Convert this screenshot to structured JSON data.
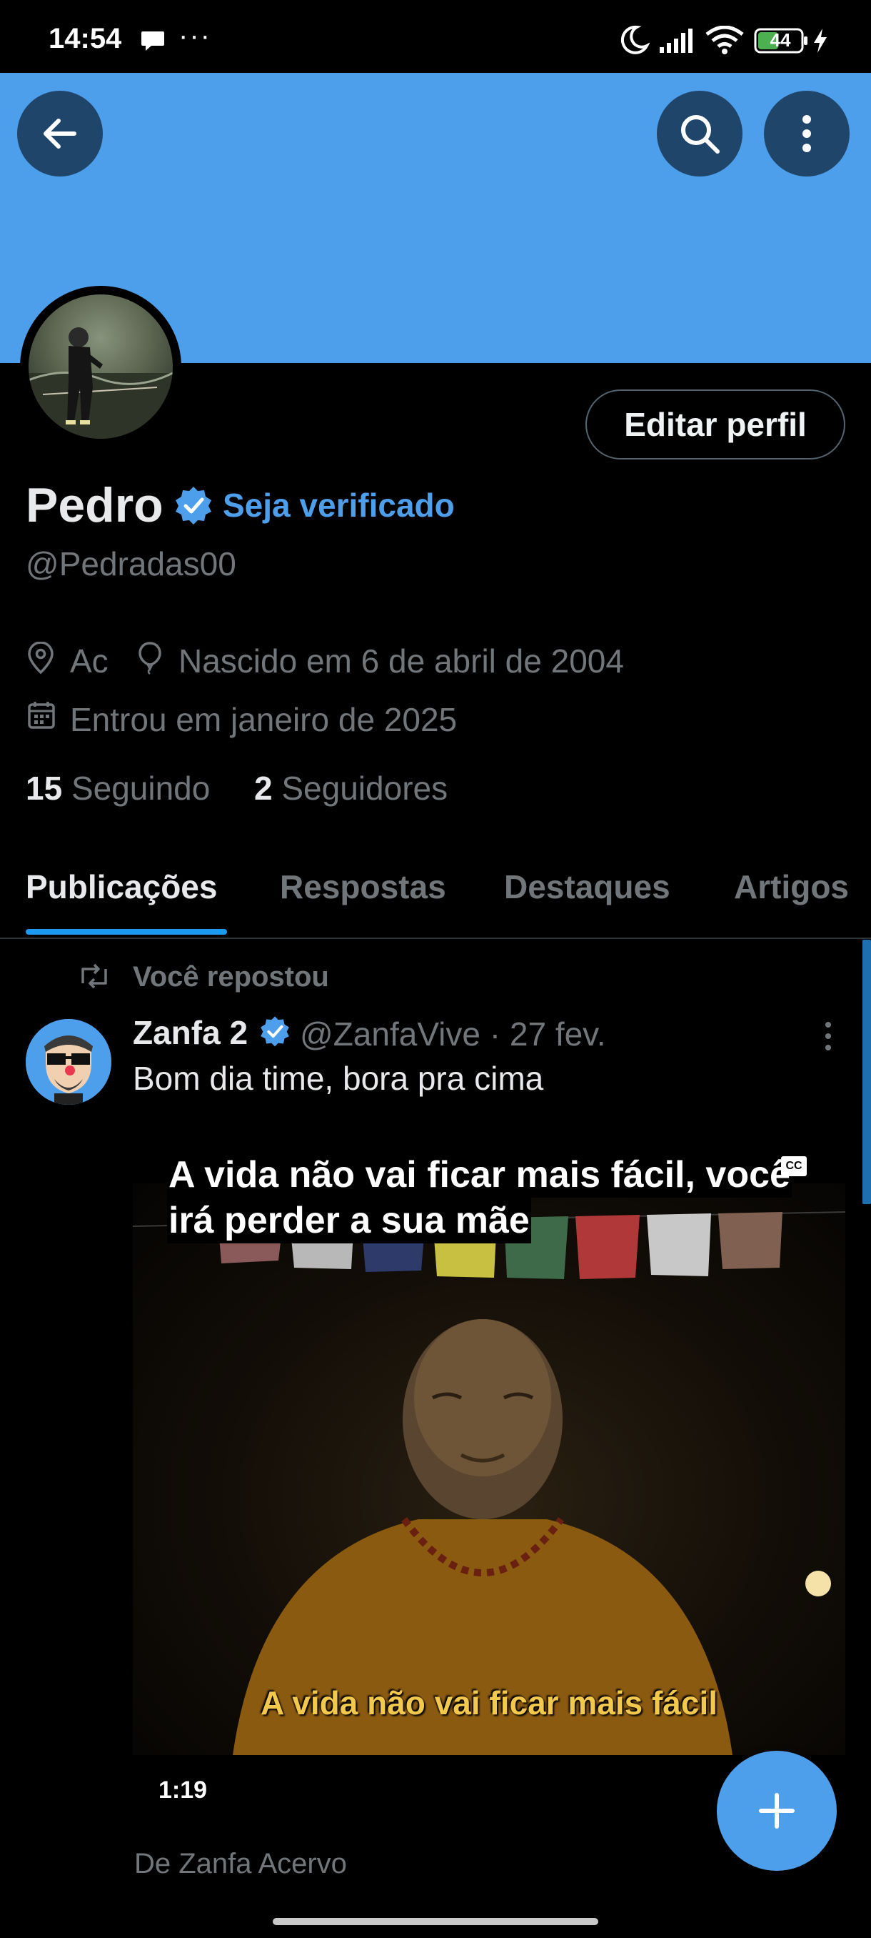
{
  "status_bar": {
    "time": "14:54",
    "more_dots": "···",
    "battery_level": "44"
  },
  "profile": {
    "name": "Pedro",
    "verify_cta": "Seja verificado",
    "handle": "@Pedradas00",
    "edit_button": "Editar perfil",
    "location": "Ac",
    "birthday": "Nascido em 6 de abril de 2004",
    "joined": "Entrou em janeiro de 2025",
    "following_count": "15",
    "following_label": "Seguindo",
    "followers_count": "2",
    "followers_label": "Seguidores"
  },
  "tabs": [
    {
      "label": "Publicações",
      "active": true
    },
    {
      "label": "Respostas",
      "active": false
    },
    {
      "label": "Destaques",
      "active": false
    },
    {
      "label": "Artigos",
      "active": false
    }
  ],
  "post": {
    "repost_label": "Você repostou",
    "author_name": "Zanfa 2",
    "author_handle": "@ZanfaVive",
    "separator": "·",
    "date": "27 fev.",
    "text": "Bom dia time, bora pra cima",
    "video": {
      "caption_line1": "A vida não vai ficar mais fácil, você",
      "caption_line2": "irá perder a sua mãe",
      "cc_label": "CC",
      "burned_subtitle": "A vida não vai ficar mais fácil",
      "duration": "1:19"
    },
    "source": "De Zanfa Acervo"
  },
  "colors": {
    "accent": "#1d9bf0",
    "banner": "#4d9fec",
    "muted_text": "#71767b",
    "background": "#000000"
  },
  "icons": {
    "back": "arrow-left-icon",
    "search": "search-icon",
    "more": "more-vertical-icon",
    "location": "location-pin-icon",
    "birthday": "balloon-icon",
    "calendar": "calendar-icon",
    "repost": "repost-icon",
    "verified": "verified-badge-icon",
    "compose": "plus-icon"
  }
}
